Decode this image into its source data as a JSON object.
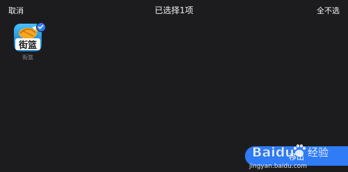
{
  "topbar": {
    "cancel_label": "取消",
    "title": "已选择1项",
    "deselect_all_label": "全不选"
  },
  "apps": [
    {
      "label": "街篮",
      "selected": true,
      "icon": "street-basketball-app-icon",
      "icon_text": "街篮"
    }
  ],
  "action": {
    "label": "移出"
  },
  "watermark": {
    "brand": "Baidu",
    "suffix": "经验",
    "url": "jingyan.baidu.com"
  },
  "colors": {
    "background": "#1c1c1e",
    "accent": "#2f7cf6",
    "text_primary": "#f2f2f2",
    "text_secondary": "#8e8e93"
  }
}
